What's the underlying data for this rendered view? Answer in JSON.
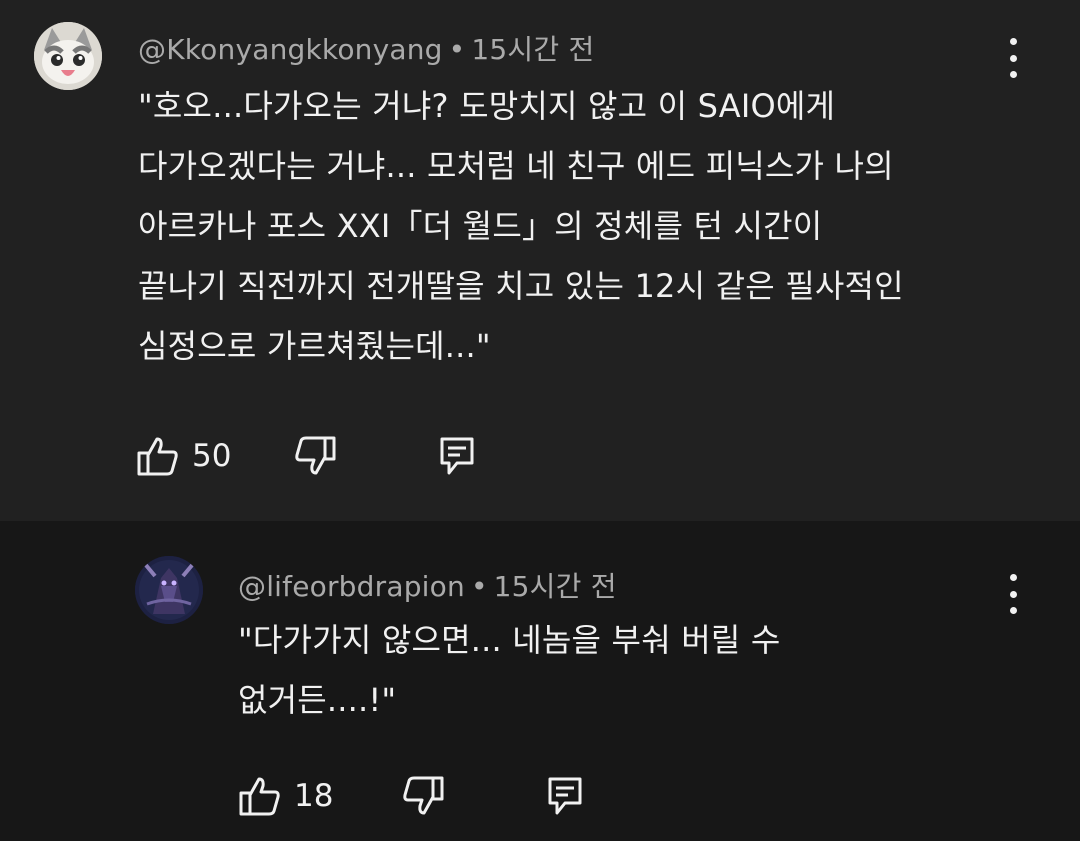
{
  "comments": [
    {
      "handle": "@Kkonyangkkonyang",
      "separator": "•",
      "time": "15시간 전",
      "lines": [
        "\"호오...다가오는 거냐? 도망치지 않고 이 SAIO에게",
        "다가오겠다는 거냐... 모처럼 네 친구 에드 피닉스가 나의",
        "아르카나 포스 XXI「더 월드」의 정체를 턴 시간이",
        "끝나기 직전까지 전개딸을 치고 있는 12시 같은 필사적인",
        "심정으로 가르쳐줬는데...\""
      ],
      "likes": "50"
    },
    {
      "handle": "@lifeorbdrapion",
      "separator": "•",
      "time": "15시간 전",
      "lines": [
        "\"다가가지 않으면... 네놈을 부숴 버릴 수",
        "없거든....!\""
      ],
      "likes": "18"
    }
  ],
  "icons": {
    "like": "thumbs-up-icon",
    "dislike": "thumbs-down-icon",
    "reply": "reply-icon",
    "more": "more-vertical-icon"
  },
  "colors": {
    "background": "#212121",
    "reply_background": "#171717",
    "text": "#f1f1f1",
    "meta": "#aaaaaa"
  }
}
